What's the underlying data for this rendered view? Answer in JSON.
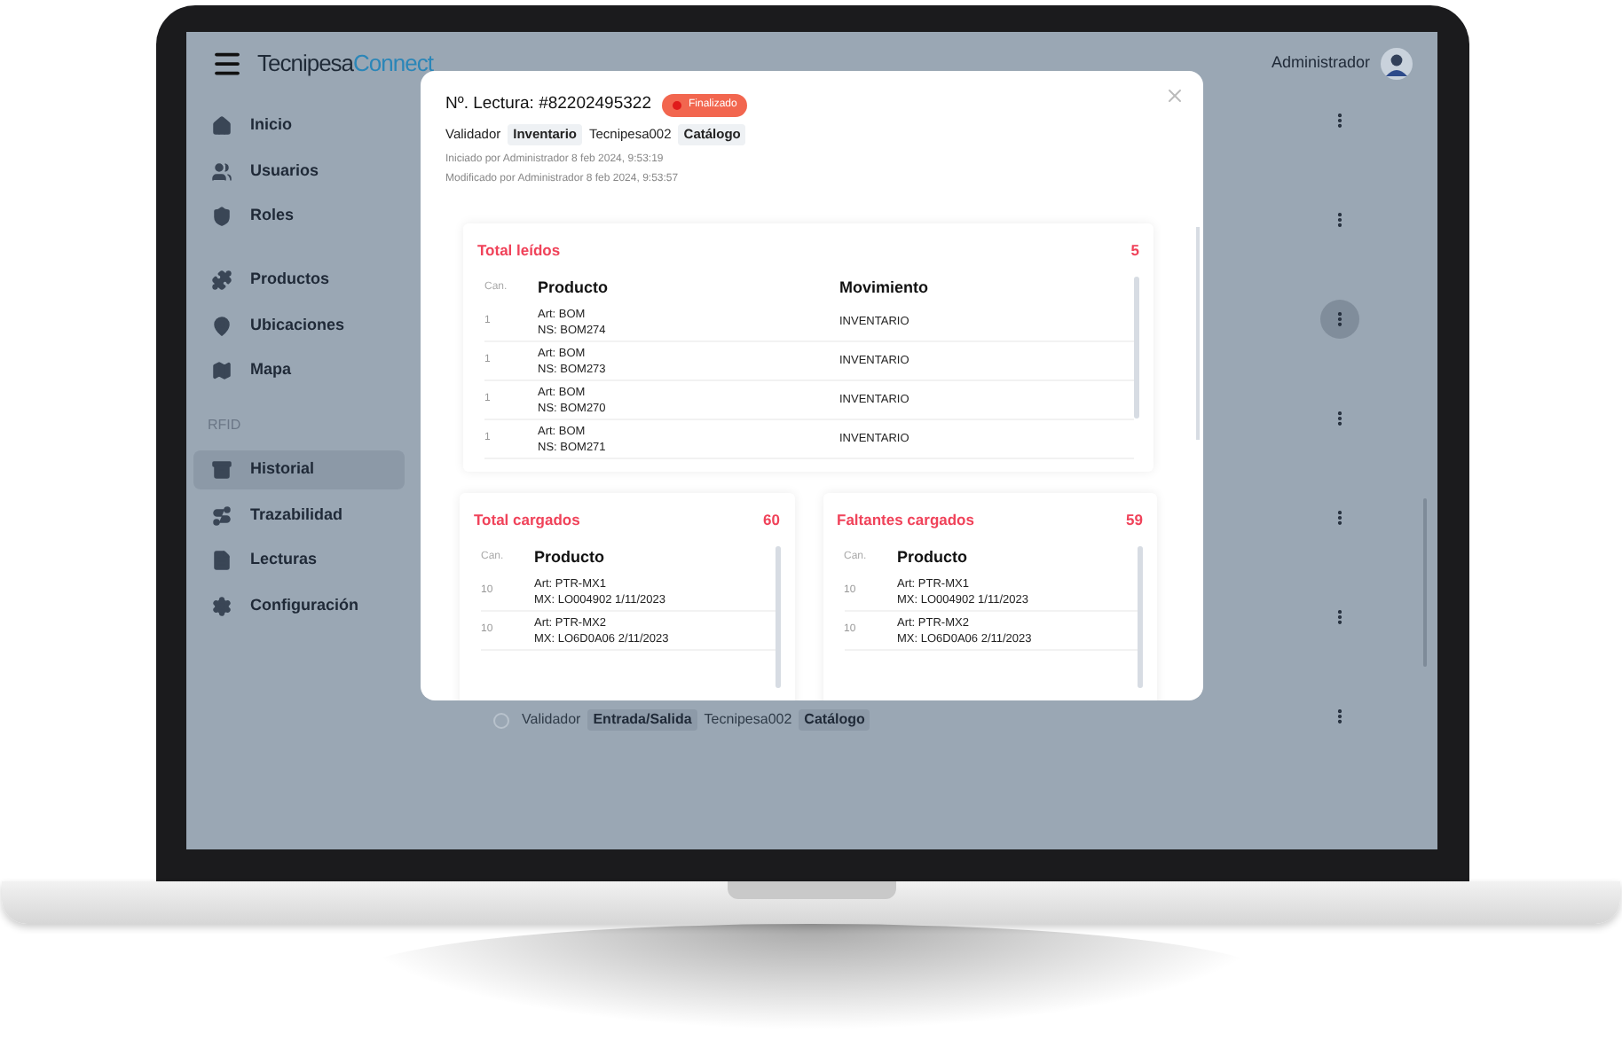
{
  "header": {
    "logo_first": "Tecnipesa",
    "logo_second": "Connect",
    "user": "Administrador"
  },
  "sidebar": {
    "groups": [
      {
        "items": [
          {
            "label": "Inicio",
            "selected": false
          },
          {
            "label": "Usuarios",
            "selected": false
          },
          {
            "label": "Roles",
            "selected": false
          }
        ]
      },
      {
        "items": [
          {
            "label": "Productos",
            "selected": false
          },
          {
            "label": "Ubicaciones",
            "selected": false
          },
          {
            "label": "Mapa",
            "selected": false
          }
        ]
      },
      {
        "heading": "RFID",
        "items": [
          {
            "label": "Historial",
            "selected": true
          },
          {
            "label": "Trazabilidad",
            "selected": false
          },
          {
            "label": "Lecturas",
            "selected": false
          },
          {
            "label": "Configuración",
            "selected": false
          }
        ]
      }
    ]
  },
  "list": {
    "rows": [
      {
        "menu_selected": false
      },
      {
        "menu_selected": false
      },
      {
        "menu_selected": true
      },
      {
        "menu_selected": false
      },
      {
        "menu_selected": false
      },
      {
        "menu_selected": false
      },
      {
        "menu_selected": false,
        "checked": false,
        "tags": [
          {
            "kind": "plain",
            "text": "Validador"
          },
          {
            "kind": "chip",
            "text": "Entrada/Salida"
          },
          {
            "kind": "plain",
            "text": "Tecnipesa002"
          },
          {
            "kind": "chip",
            "text": "Catálogo"
          }
        ]
      }
    ]
  },
  "modal": {
    "title": "Nº. Lectura: #82202495322",
    "status": "Finalizado",
    "tags": [
      {
        "kind": "plain",
        "text": "Validador"
      },
      {
        "kind": "chip",
        "text": "Inventario"
      },
      {
        "kind": "plain",
        "text": "Tecnipesa002"
      },
      {
        "kind": "chip",
        "text": "Catálogo"
      }
    ],
    "started": "Iniciado por Administrador 8 feb 2024, 9:53:19",
    "modified": "Modificado por Administrador 8 feb 2024, 9:53:57",
    "read": {
      "title": "Total leídos",
      "count": "5",
      "columns": [
        "Can.",
        "Producto",
        "Movimiento"
      ],
      "rows": [
        {
          "qty": "1",
          "lines": [
            "Art: BOM",
            "NS: BOM274"
          ],
          "movement": "INVENTARIO"
        },
        {
          "qty": "1",
          "lines": [
            "Art: BOM",
            "NS: BOM273"
          ],
          "movement": "INVENTARIO"
        },
        {
          "qty": "1",
          "lines": [
            "Art: BOM",
            "NS: BOM270"
          ],
          "movement": "INVENTARIO"
        },
        {
          "qty": "1",
          "lines": [
            "Art: BOM",
            "NS: BOM271"
          ],
          "movement": "INVENTARIO"
        }
      ]
    },
    "loaded": [
      {
        "title": "Total cargados",
        "count": "60",
        "columns": [
          "Can.",
          "Producto"
        ],
        "rows": [
          {
            "qty": "10",
            "lines": [
              "Art: PTR-MX1",
              "MX: LO004902 1/11/2023"
            ]
          },
          {
            "qty": "10",
            "lines": [
              "Art: PTR-MX2",
              "MX: LO6D0A06 2/11/2023"
            ]
          }
        ]
      },
      {
        "title": "Faltantes cargados",
        "count": "59",
        "columns": [
          "Can.",
          "Producto"
        ],
        "rows": [
          {
            "qty": "10",
            "lines": [
              "Art: PTR-MX1",
              "MX: LO004902 1/11/2023"
            ]
          },
          {
            "qty": "10",
            "lines": [
              "Art: PTR-MX2",
              "MX: LO6D0A06 2/11/2023"
            ]
          }
        ]
      }
    ]
  }
}
